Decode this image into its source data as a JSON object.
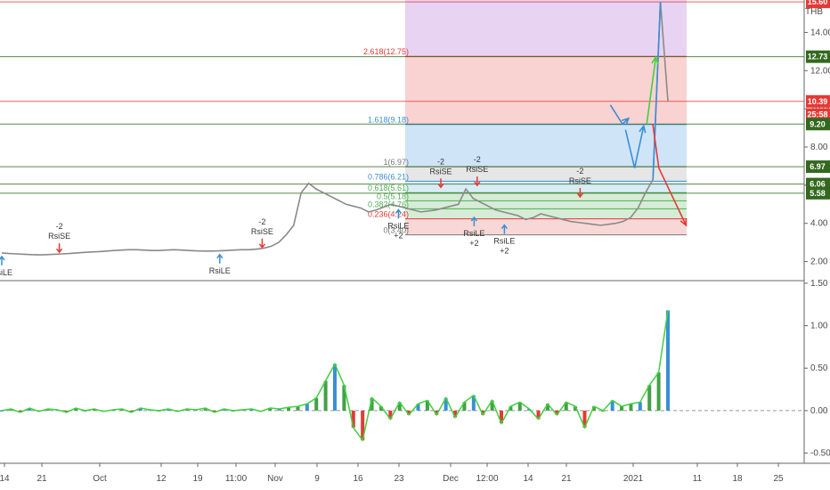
{
  "chart_data": [
    {
      "type": "line",
      "panel": "price",
      "currency": "THB",
      "ylim": [
        1.0,
        15.7
      ],
      "y_ticks": [
        2.0,
        4.0,
        6.0,
        8.0,
        10.0,
        12.0,
        14.0
      ],
      "series": [
        {
          "color": "#9e9e9e",
          "values": [
            2.45,
            2.42,
            2.4,
            2.38,
            2.36,
            2.35,
            2.36,
            2.38,
            2.4,
            2.42,
            2.45,
            2.48,
            2.5,
            2.52,
            2.55,
            2.58,
            2.6,
            2.62,
            2.62,
            2.6,
            2.58,
            2.58,
            2.6,
            2.62,
            2.6,
            2.58,
            2.56,
            2.55,
            2.55,
            2.56,
            2.58,
            2.6,
            2.62,
            2.62,
            2.65,
            2.7,
            2.8,
            3.0,
            3.4,
            3.9,
            5.6,
            6.1,
            5.8,
            5.6,
            5.4,
            5.2,
            5.0,
            4.9,
            4.8,
            4.6,
            4.7,
            4.85,
            5.0,
            4.9,
            4.8,
            4.7,
            4.6,
            4.65,
            4.7,
            4.8,
            4.9,
            5.0,
            5.8,
            5.3,
            5.1,
            4.9,
            4.7,
            4.6,
            4.5,
            4.4,
            4.2,
            4.3,
            4.5,
            4.4,
            4.3,
            4.2,
            4.1,
            4.05,
            4.0,
            3.95,
            3.9,
            3.95,
            4.0,
            4.1,
            4.3,
            4.8,
            5.6,
            6.3,
            15.6,
            10.4
          ]
        }
      ],
      "fib_levels": [
        {
          "label": "0(3.40)",
          "value": 3.4,
          "color": "#787878"
        },
        {
          "label": "0.236(4.24)",
          "value": 4.24,
          "color": "#e53935"
        },
        {
          "label": "0.382(4.76)",
          "value": 4.76,
          "color": "#4caf50"
        },
        {
          "label": "0.5(5.18)",
          "value": 5.18,
          "color": "#4caf50"
        },
        {
          "label": "0.618(5.61)",
          "value": 5.61,
          "color": "#4caf50"
        },
        {
          "label": "0.786(6.21)",
          "value": 6.21,
          "color": "#3a8fd6"
        },
        {
          "label": "1(6.97)",
          "value": 6.97,
          "color": "#787878"
        },
        {
          "label": "1.618(9.18)",
          "value": 9.18,
          "color": "#3a8fd6"
        },
        {
          "label": "2.618(12.75)",
          "value": 12.75,
          "color": "#e53935"
        }
      ],
      "price_badges": [
        {
          "label": "15.60",
          "value": 15.6,
          "color": "#e53935"
        },
        {
          "label": "12.73",
          "value": 12.73,
          "color": "#33691e"
        },
        {
          "label": "10.39",
          "value": 10.39,
          "color": "#e53935"
        },
        {
          "label": "25:58",
          "value": 9.7,
          "color": "#e53935"
        },
        {
          "label": "9.20",
          "value": 9.2,
          "color": "#33691e"
        },
        {
          "label": "6.97",
          "value": 6.97,
          "color": "#33691e"
        },
        {
          "label": "6.06",
          "value": 6.06,
          "color": "#33691e"
        },
        {
          "label": "5.58",
          "value": 5.58,
          "color": "#33691e"
        }
      ],
      "signals": [
        {
          "type": "RsiLE",
          "x": 0,
          "value": 2.45
        },
        {
          "type": "RsiSE",
          "x": 19,
          "value": 2.3,
          "count": "-2"
        },
        {
          "type": "RsiLE",
          "x": 72,
          "value": 2.55
        },
        {
          "type": "RsiSE",
          "x": 86,
          "value": 2.55,
          "count": "-2"
        },
        {
          "type": "RsiLE",
          "x": 131,
          "value": 4.9,
          "count": "+2"
        },
        {
          "type": "RsiSE",
          "x": 145,
          "value": 5.7,
          "count": "-2"
        },
        {
          "type": "RsiSE",
          "x": 157,
          "value": 5.8,
          "count": "-2"
        },
        {
          "type": "RsiLE",
          "x": 156,
          "value": 4.5,
          "count": "+2"
        },
        {
          "type": "RsiLE",
          "x": 166,
          "value": 4.1,
          "count": "+2"
        },
        {
          "type": "RsiSE",
          "x": 191,
          "value": 5.2,
          "count": "-2"
        }
      ],
      "projection_paths": [
        {
          "color": "#3a8fd6",
          "points": [
            [
              201,
              10.2
            ],
            [
              205,
              9.2
            ],
            [
              207,
              9.5
            ]
          ]
        },
        {
          "color": "#3a8fd6",
          "points": [
            [
              206,
              8.9
            ],
            [
              209,
              6.9
            ],
            [
              212,
              9.1
            ]
          ]
        },
        {
          "color": "#3fd13f",
          "points": [
            [
              213,
              9.2
            ],
            [
              216,
              12.7
            ]
          ]
        },
        {
          "color": "#e53935",
          "points": [
            [
              215,
              9.2
            ],
            [
              217,
              6.9
            ],
            [
              226,
              3.9
            ]
          ]
        }
      ]
    },
    {
      "type": "bar",
      "panel": "oscillator",
      "ylim": [
        -0.62,
        1.52
      ],
      "y_ticks": [
        -0.5,
        0.0,
        0.5,
        1.0,
        1.5
      ],
      "series": [
        {
          "color": "#3fd13f",
          "values": [
            0.0,
            0.02,
            -0.02,
            0.03,
            -0.01,
            0.02,
            0.01,
            -0.02,
            0.03,
            0.0,
            0.02,
            -0.01,
            0.01,
            0.02,
            -0.02,
            0.03,
            0.01,
            0.0,
            0.02,
            -0.01,
            0.02,
            0.01,
            0.03,
            -0.02,
            0.02,
            0.0,
            0.01,
            0.02,
            -0.01,
            0.03,
            0.02,
            0.04,
            0.05,
            0.08,
            0.15,
            0.35,
            0.55,
            0.3,
            -0.2,
            -0.35,
            0.15,
            0.05,
            -0.1,
            0.1,
            -0.05,
            0.08,
            0.12,
            -0.05,
            0.15,
            -0.08,
            0.1,
            0.18,
            -0.05,
            0.12,
            -0.15,
            0.05,
            0.1,
            0.02,
            -0.1,
            0.08,
            -0.05,
            0.1,
            0.05,
            -0.2,
            0.05,
            0.0,
            0.12,
            0.05,
            0.08,
            0.1,
            0.3,
            0.45,
            1.18
          ]
        }
      ]
    }
  ],
  "axis_time": [
    "14",
    "21",
    "Oct",
    "12",
    "19",
    "11:00",
    "Nov",
    "9",
    "16",
    "23",
    "Dec",
    "12:00",
    "14",
    "21",
    "2021",
    "11",
    "18",
    "25"
  ]
}
